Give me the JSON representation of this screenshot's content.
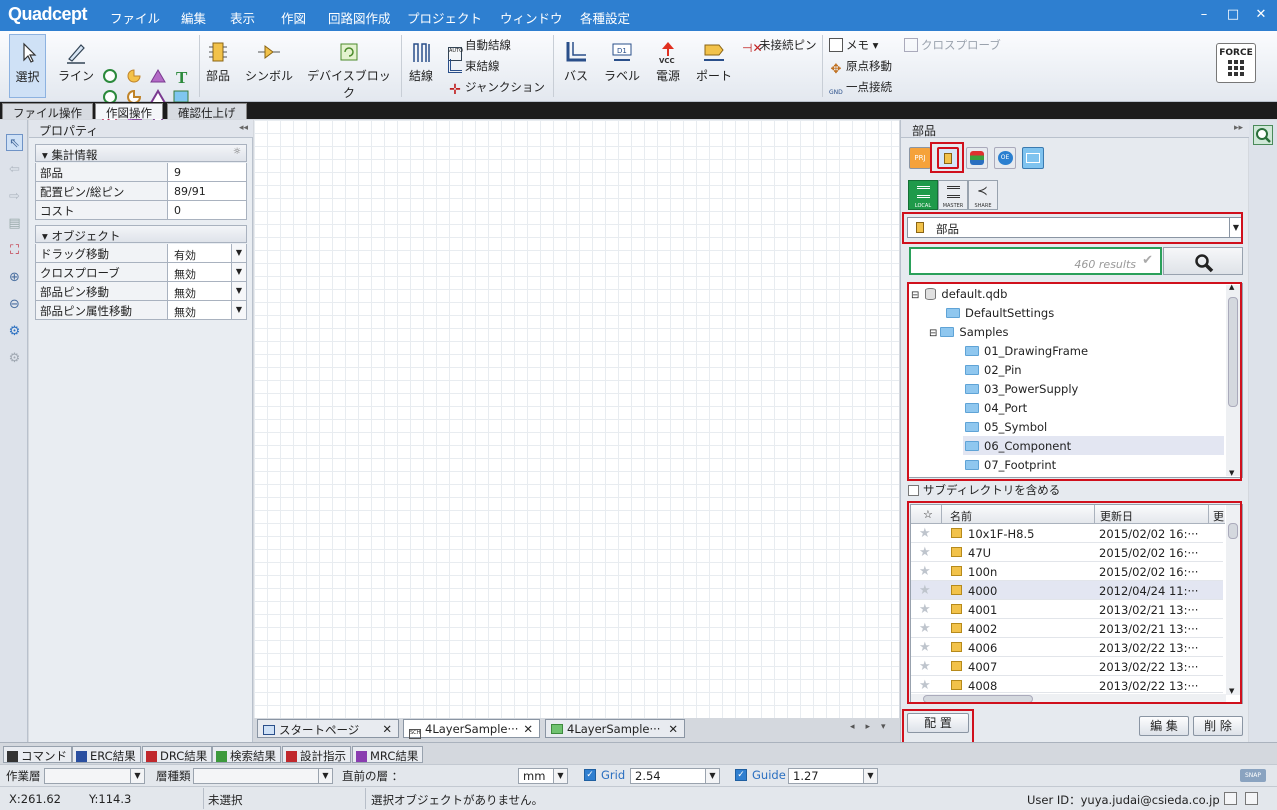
{
  "app": {
    "logo": "Quadcept"
  },
  "menu": [
    "ファイル",
    "編集",
    "表示",
    "作図",
    "回路図作成",
    "プロジェクト",
    "ウィンドウ",
    "各種設定"
  ],
  "window_controls": {
    "minimize": "–",
    "restore": "□",
    "close": "✕"
  },
  "ribbon": {
    "select": "選択",
    "line": "ライン",
    "part": "部品",
    "symbol": "シンボル",
    "device_block": "デバイスブロック",
    "wire": "結線",
    "auto_wire": "自動結線",
    "bundle_wire": "束結線",
    "junction": "ジャンクション",
    "bus": "バス",
    "label": "ラベル",
    "power": "電源",
    "port": "ポート",
    "unconnected_pin": "未接続ピン",
    "memo": "メモ",
    "origin_move": "原点移動",
    "one_point_connect": "一点接続",
    "cross_probe": "クロスプローブ",
    "force": "FORCE"
  },
  "ribbon_tabs": [
    "ファイル操作",
    "作図操作",
    "確認仕上げ"
  ],
  "properties": {
    "title": "プロパティ",
    "collapse": "◂◂",
    "group_summary": "集計情報",
    "summary_rows": [
      {
        "key": "部品",
        "value": "9"
      },
      {
        "key": "配置ピン/総ピン",
        "value": "89/91"
      },
      {
        "key": "コスト",
        "value": "0"
      }
    ],
    "group_object": "オブジェクト",
    "object_rows": [
      {
        "key": "ドラッグ移動",
        "value": "有効"
      },
      {
        "key": "クロスプローブ",
        "value": "無効"
      },
      {
        "key": "部品ピン移動",
        "value": "無効"
      },
      {
        "key": "部品ピン属性移動",
        "value": "無効"
      }
    ]
  },
  "doc_tabs": [
    "スタートページ",
    "4LayerSample···",
    "4LayerSample···"
  ],
  "parts_panel": {
    "title": "部品",
    "expand": "▸▸",
    "lib_icons": [
      "PRJ",
      "part-lib",
      "layers",
      "OE",
      "pc"
    ],
    "modes": [
      "LOCAL",
      "MASTER",
      "SHARE"
    ],
    "category": "部品",
    "search_results": "460 results",
    "tree": [
      {
        "label": "default.qdb",
        "level": 0,
        "toggle": "⊟",
        "type": "db"
      },
      {
        "label": "DefaultSettings",
        "level": 1,
        "toggle": "",
        "type": "folder"
      },
      {
        "label": "Samples",
        "level": 1,
        "toggle": "⊟",
        "type": "folder"
      },
      {
        "label": "01_DrawingFrame",
        "level": 2,
        "toggle": "",
        "type": "folder"
      },
      {
        "label": "02_Pin",
        "level": 2,
        "toggle": "",
        "type": "folder"
      },
      {
        "label": "03_PowerSupply",
        "level": 2,
        "toggle": "",
        "type": "folder"
      },
      {
        "label": "04_Port",
        "level": 2,
        "toggle": "",
        "type": "folder"
      },
      {
        "label": "05_Symbol",
        "level": 2,
        "toggle": "",
        "type": "folder"
      },
      {
        "label": "06_Component",
        "level": 2,
        "toggle": "",
        "type": "folder",
        "selected": true
      },
      {
        "label": "07_Footprint",
        "level": 2,
        "toggle": "",
        "type": "folder"
      }
    ],
    "include_subdirs": "サブディレクトリを含める",
    "columns": [
      "☆",
      "名前",
      "更新日",
      "更"
    ],
    "parts": [
      {
        "name": "10x1F-H8.5",
        "date": "2015/02/02 16:···"
      },
      {
        "name": "47U",
        "date": "2015/02/02 16:···"
      },
      {
        "name": "100n",
        "date": "2015/02/02 16:···"
      },
      {
        "name": "4000",
        "date": "2012/04/24 11:···",
        "selected": true
      },
      {
        "name": "4001",
        "date": "2013/02/21 13:···"
      },
      {
        "name": "4002",
        "date": "2013/02/21 13:···"
      },
      {
        "name": "4006",
        "date": "2013/02/22 13:···"
      },
      {
        "name": "4007",
        "date": "2013/02/22 13:···"
      },
      {
        "name": "4008",
        "date": "2013/02/22 13:···"
      }
    ],
    "place_button": "配 置",
    "edit_button": "編 集",
    "delete_button": "削 除"
  },
  "output_tabs": [
    "コマンド",
    "ERC結果",
    "DRC結果",
    "検索結果",
    "設計指示",
    "MRC結果"
  ],
  "output_tab_colors": [
    "#333333",
    "#2a4fa0",
    "#c0282d",
    "#3d9a3d",
    "#c0282d",
    "#8a3db0"
  ],
  "layerbar": {
    "work_layer_label": "作業層",
    "layer_type_label": "層種類",
    "prev_layer_label": "直前の層 ：",
    "unit": "mm",
    "grid_label": "Grid",
    "grid_value": "2.54",
    "guide_label": "Guide",
    "guide_value": "1.27",
    "snap": "SNAP"
  },
  "status": {
    "x": "X:261.62",
    "y": "Y:114.3",
    "selection": "未選択",
    "message": "選択オブジェクトがありません。",
    "user": "User ID：yuya.judai@csieda.co.jp"
  }
}
